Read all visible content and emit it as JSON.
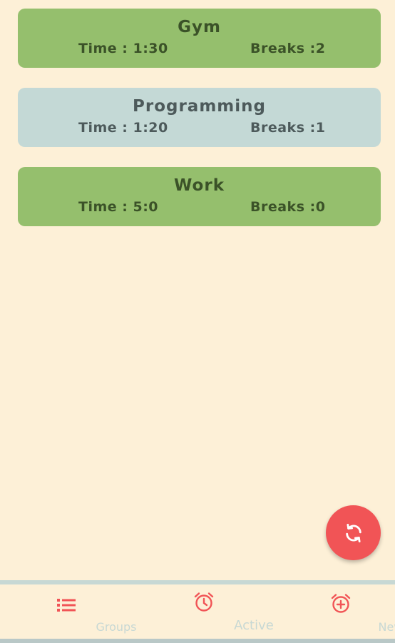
{
  "groups": [
    {
      "title": "Gym",
      "time": "Time : 1:30",
      "breaks": "Breaks :2",
      "color": "green"
    },
    {
      "title": "Programming",
      "time": "Time : 1:20",
      "breaks": "Breaks :1",
      "color": "blue"
    },
    {
      "title": "Work",
      "time": "Time : 5:0",
      "breaks": "Breaks :0",
      "color": "green"
    }
  ],
  "fab": {
    "icon": "refresh-icon"
  },
  "nav": {
    "groups_label": "Groups",
    "active_label": "Active",
    "new_label": "New"
  },
  "colors": {
    "background": "#fdf0d7",
    "green_card": "#95bf6d",
    "blue_card": "#c4d9d6",
    "accent": "#f15456",
    "nav_inactive": "#c7d8d4"
  }
}
